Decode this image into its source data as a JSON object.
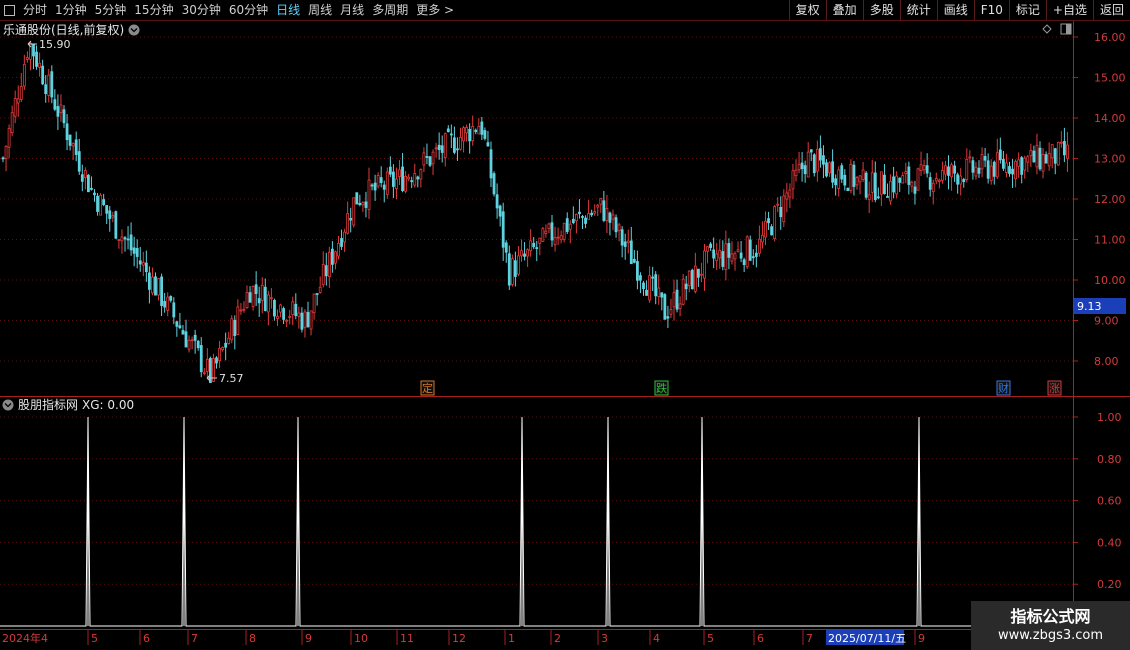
{
  "toolbar": {
    "left_items": [
      "分时",
      "1分钟",
      "5分钟",
      "15分钟",
      "30分钟",
      "60分钟",
      "日线",
      "周线",
      "月线",
      "多周期",
      "更多 >"
    ],
    "active_item": "日线",
    "right_items": [
      "复权",
      "叠加",
      "多股",
      "统计",
      "画线",
      "F10",
      "标记",
      "+自选",
      "返回"
    ]
  },
  "main_chart": {
    "title": "乐通股份(日线,前复权)",
    "high_marker": "15.90",
    "low_marker": "7.57",
    "current_price_tag": "9.13",
    "price_axis_labels": [
      "16.00",
      "15.00",
      "14.00",
      "13.00",
      "12.00",
      "11.00",
      "10.00",
      "9.00",
      "8.00"
    ],
    "event_chips": [
      {
        "text": "定",
        "color": "#d4762a"
      },
      {
        "text": "跌",
        "color": "#2fbf3a"
      },
      {
        "text": "财",
        "color": "#3a78e0"
      },
      {
        "text": "涨",
        "color": "#d23b3b"
      }
    ],
    "up_color": "#e23a3a",
    "down_color": "#5fd3e0"
  },
  "indicator": {
    "title": "股朋指标网",
    "value_text": "XG: 0.00",
    "axis_labels": [
      "1.00",
      "0.80",
      "0.60",
      "0.40",
      "0.20"
    ]
  },
  "x_axis": {
    "labels": [
      "2024年4",
      "5",
      "6",
      "7",
      "8",
      "9",
      "10",
      "11",
      "12",
      "1",
      "2",
      "3",
      "4",
      "5",
      "6",
      "7",
      "2025/07/11/五",
      "9"
    ]
  },
  "watermark": {
    "title": "指标公式网",
    "url": "www.zbgs3.com"
  },
  "chart_data": [
    {
      "type": "candlestick",
      "title": "乐通股份(日线,前复权)",
      "ylim": [
        7.6,
        16.1
      ],
      "y_ticks": [
        8,
        9,
        10,
        11,
        12,
        13,
        14,
        15,
        16
      ],
      "x_period": "2024-04 to 2025-09 (daily)",
      "close_path_by_month": [
        {
          "x": "2024-04",
          "close": 13.0
        },
        {
          "x": "2024-04 late",
          "close": 15.9
        },
        {
          "x": "2024-05",
          "close": 12.2
        },
        {
          "x": "2024-06",
          "close": 10.3
        },
        {
          "x": "2024-07",
          "close": 7.6
        },
        {
          "x": "2024-08",
          "close": 9.8
        },
        {
          "x": "2024-09",
          "close": 9.0
        },
        {
          "x": "2024-10",
          "close": 12.0
        },
        {
          "x": "2024-11",
          "close": 12.5
        },
        {
          "x": "2024-12",
          "close": 13.9
        },
        {
          "x": "2025-01",
          "close": 10.2
        },
        {
          "x": "2025-02",
          "close": 11.2
        },
        {
          "x": "2025-03",
          "close": 11.8
        },
        {
          "x": "2025-04",
          "close": 9.2
        },
        {
          "x": "2025-05",
          "close": 10.5
        },
        {
          "x": "2025-06",
          "close": 10.8
        },
        {
          "x": "2025-07",
          "close": 13.0
        },
        {
          "x": "2025-08",
          "close": 12.3
        },
        {
          "x": "2025-09",
          "close": 13.1
        }
      ],
      "high": 15.9,
      "low": 7.57,
      "last": 9.13
    },
    {
      "type": "line",
      "title": "股朋指标网",
      "series": [
        {
          "name": "XG",
          "signal_months": [
            "2024-05",
            "2024-07",
            "2024-09",
            "2025-01",
            "2025-03",
            "2025-05",
            "2025-09"
          ],
          "signal_value": 1.0
        }
      ],
      "ylim": [
        0,
        1.05
      ],
      "y_ticks": [
        0.2,
        0.4,
        0.6,
        0.8,
        1.0
      ]
    }
  ]
}
